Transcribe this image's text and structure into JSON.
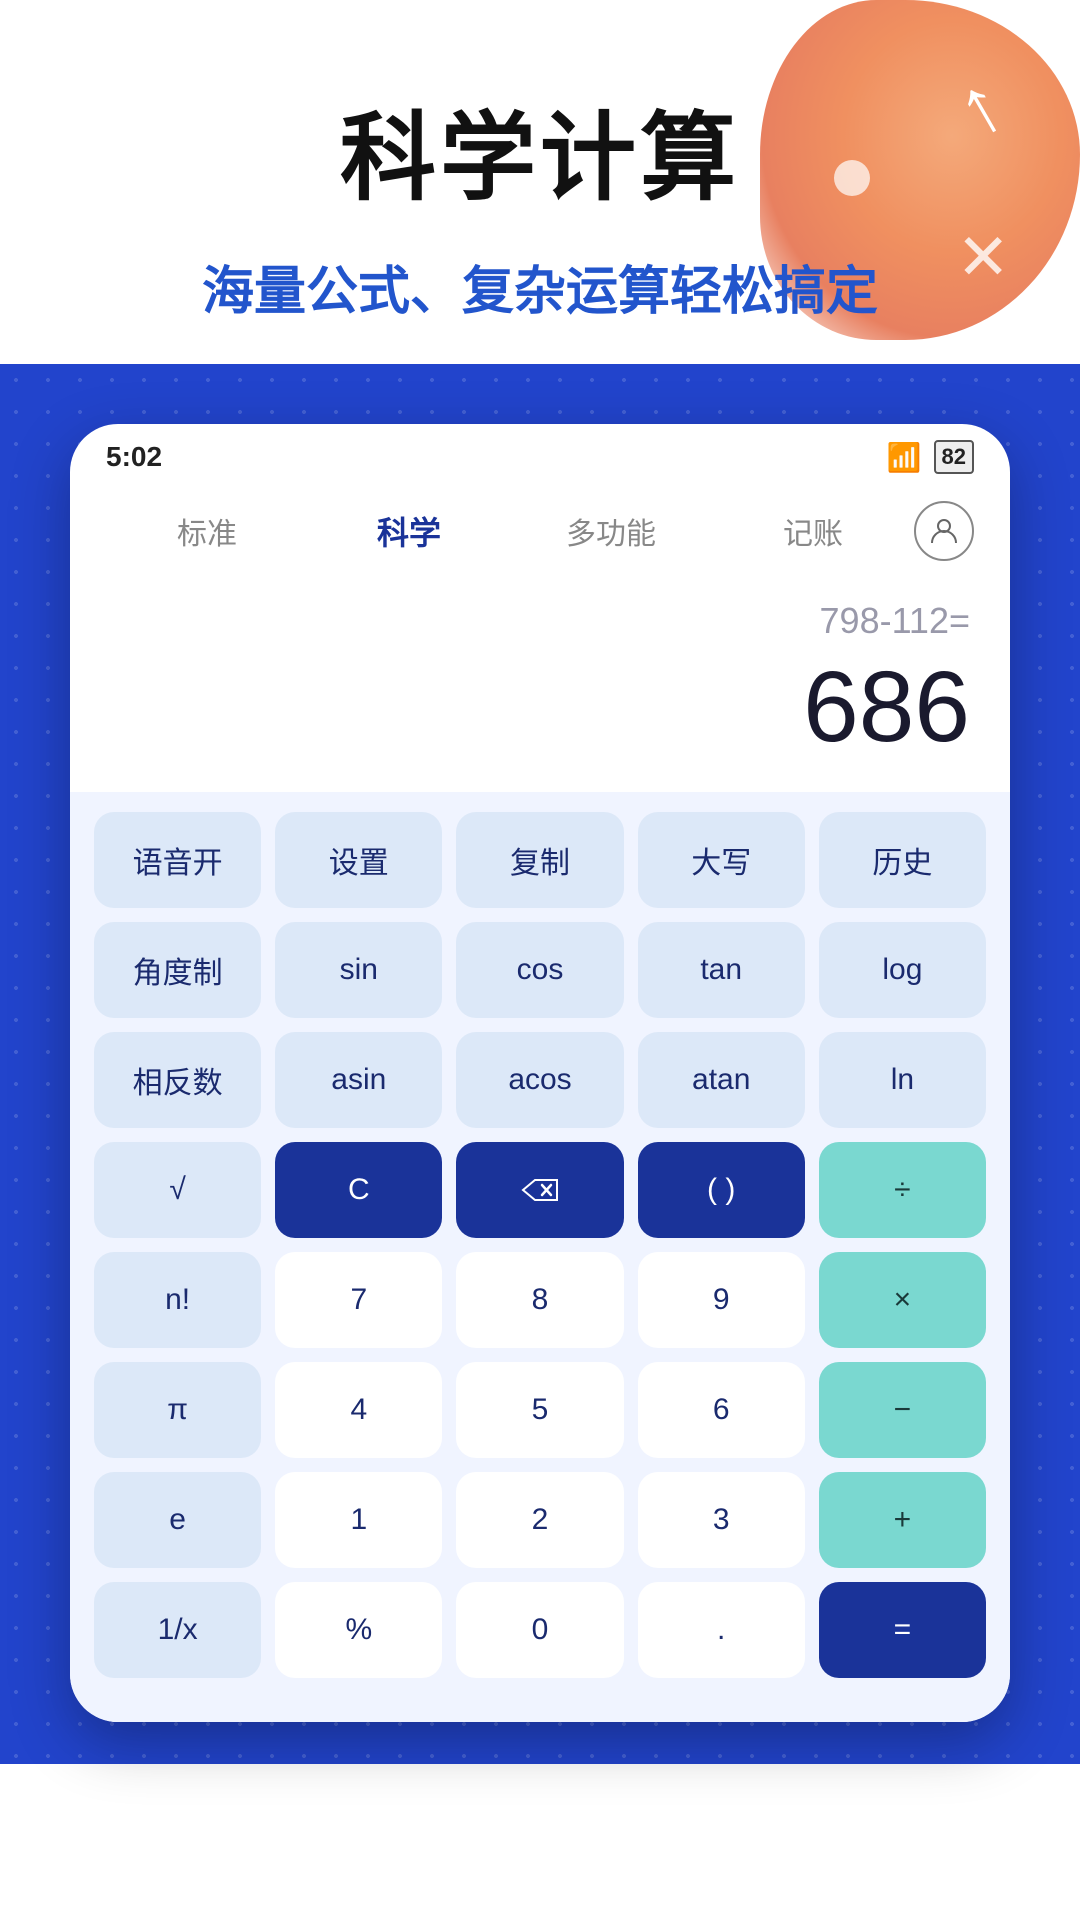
{
  "header": {
    "main_title": "科学计算",
    "sub_title": "海量公式、复杂运算轻松搞定"
  },
  "status_bar": {
    "time": "5:02",
    "battery": "82"
  },
  "nav": {
    "tabs": [
      "标准",
      "科学",
      "多功能",
      "记账"
    ],
    "active_tab": "科学"
  },
  "display": {
    "expression": "798-112=",
    "result": "686"
  },
  "keypad": {
    "row1": [
      "语音开",
      "设置",
      "复制",
      "大写",
      "历史"
    ],
    "row2": [
      "角度制",
      "sin",
      "cos",
      "tan",
      "log"
    ],
    "row3": [
      "相反数",
      "asin",
      "acos",
      "atan",
      "ln"
    ],
    "row4": [
      "√",
      "C",
      "⌫",
      "( )",
      "÷"
    ],
    "row5": [
      "n!",
      "7",
      "8",
      "9",
      "×"
    ],
    "row6": [
      "π",
      "4",
      "5",
      "6",
      "−"
    ],
    "row7": [
      "e",
      "1",
      "2",
      "3",
      "+"
    ],
    "row8": [
      "1/x",
      "%",
      "0",
      ".",
      "="
    ]
  }
}
